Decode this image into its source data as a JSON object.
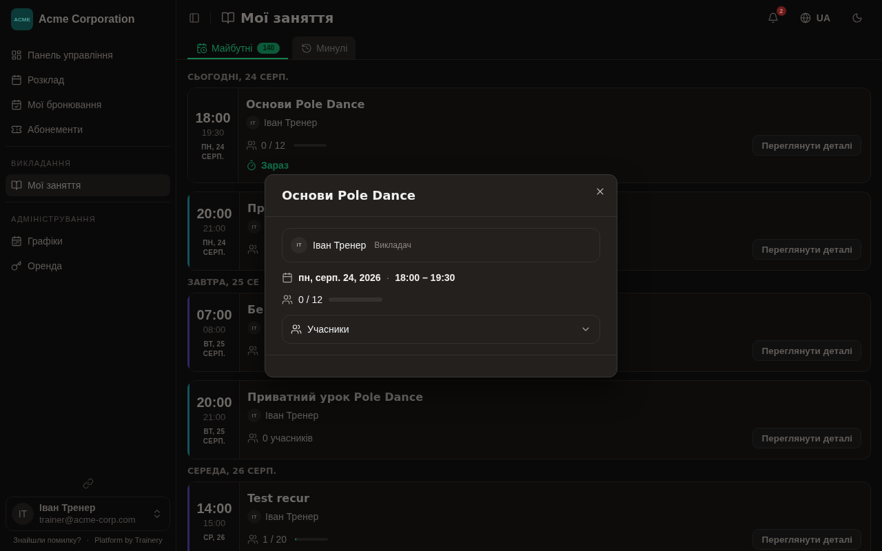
{
  "sidebar": {
    "brand": {
      "logo_text": "ACME",
      "name": "Acme Corporation"
    },
    "groups": [
      {
        "items": [
          {
            "label": "Панель управління",
            "selected": false
          },
          {
            "label": "Розклад",
            "selected": false
          },
          {
            "label": "Мої бронювання",
            "selected": false
          },
          {
            "label": "Абонементи",
            "selected": false
          }
        ]
      },
      {
        "title": "ВИКЛАДАННЯ",
        "items": [
          {
            "label": "Мої заняття",
            "selected": true
          }
        ]
      },
      {
        "title": "АДМІНІСТРУВАННЯ",
        "items": [
          {
            "label": "Графіки",
            "selected": false
          },
          {
            "label": "Оренда",
            "selected": false
          }
        ]
      }
    ],
    "user": {
      "initials": "IT",
      "name": "Іван Тренер",
      "email": "trainer@acme-corp.com"
    },
    "footer": {
      "report_link": "Знайшли помилку?",
      "separator": "·",
      "credit": "Platform by Trainery"
    }
  },
  "header": {
    "title": "Мої заняття",
    "notification_count": "2",
    "language": "UA"
  },
  "tabs": [
    {
      "label": "Майбутні",
      "count": "140",
      "selected": true
    },
    {
      "label": "Минулі",
      "selected": false
    }
  ],
  "days": [
    {
      "heading": "СЬОГОДНІ, 24 СЕРП.",
      "sessions": [
        {
          "start": "18:00",
          "end": "19:30",
          "date_lines": [
            "ПН, 24",
            "СЕРП."
          ],
          "title": "Основи Pole Dance",
          "instructor": {
            "initials": "IT",
            "name": "Іван Тренер"
          },
          "participants": {
            "kind": "capacity",
            "text": "0 / 12",
            "level": 0
          },
          "status": "Зараз",
          "action": "Переглянути деталі"
        },
        {
          "start": "20:00",
          "end": "21:00",
          "date_lines": [
            "ПН, 24",
            "СЕРП."
          ],
          "color": "#0f555c",
          "title": "Пр",
          "instructor": {
            "initials": "IT"
          },
          "participants": {
            "kind": "count"
          },
          "action": "Переглянути деталі"
        }
      ]
    },
    {
      "heading": "ЗАВТРА, 25 СЕ",
      "sessions": [
        {
          "start": "07:00",
          "end": "08:00",
          "date_lines": [
            "ВТ, 25",
            "СЕРП."
          ],
          "color": "#2b2860",
          "title": "Бе",
          "instructor": {
            "initials": "IT"
          },
          "participants": {
            "kind": "count"
          },
          "action": "Переглянути деталі"
        },
        {
          "start": "20:00",
          "end": "21:00",
          "date_lines": [
            "ВТ, 25",
            "СЕРП."
          ],
          "color": "#0f555c",
          "title": "Приватний урок Pole Dance",
          "instructor": {
            "initials": "IT",
            "name": "Іван Тренер"
          },
          "participants": {
            "kind": "count",
            "text": "0 учасників"
          },
          "action": "Переглянути деталі"
        }
      ]
    },
    {
      "heading": "СЕРЕДА, 26 СЕРП.",
      "sessions": [
        {
          "start": "14:00",
          "end": "15:00",
          "date_lines": [
            "СР, 26"
          ],
          "color": "#2b2860",
          "title": "Test recur",
          "instructor": {
            "initials": "IT",
            "name": "Іван Тренер"
          },
          "participants": {
            "kind": "capacity",
            "text": "1 / 20",
            "level": 0.05
          },
          "action": "Переглянути деталі"
        }
      ]
    }
  ],
  "modal": {
    "title": "Основи Pole Dance",
    "instructor": {
      "initials": "IT",
      "name": "Іван Тренер",
      "role": "Викладач"
    },
    "date": "пн, серп. 24, 2026",
    "separator": "·",
    "time": "18:00 – 19:30",
    "capacity": {
      "text": "0 / 12",
      "level": 0
    },
    "participants": {
      "label": "Учасники",
      "expanded": false
    }
  }
}
